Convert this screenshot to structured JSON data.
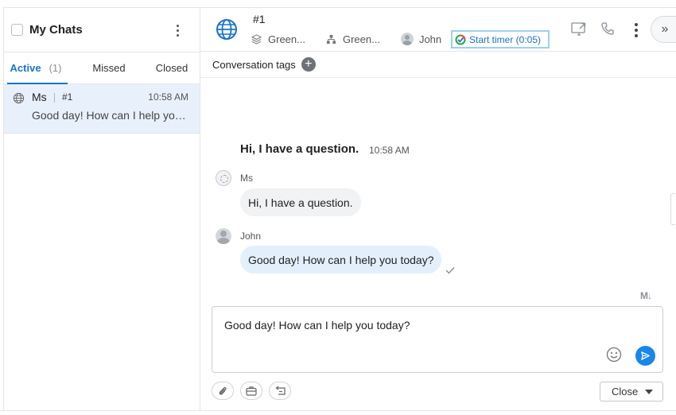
{
  "sidebar": {
    "title": "My Chats",
    "tabs": [
      {
        "label": "Active",
        "count": "(1)"
      },
      {
        "label": "Missed"
      },
      {
        "label": "Closed"
      }
    ],
    "chats": [
      {
        "name": "Ms",
        "number": "#1",
        "time": "10:58 AM",
        "preview": "Good day! How can I help you today?"
      }
    ]
  },
  "header": {
    "chat_number": "#1",
    "department": "Green...",
    "group": "Green...",
    "agent": "John",
    "timer_label": "Start timer (0:05)"
  },
  "tags": {
    "label": "Conversation tags",
    "add": "+"
  },
  "messages": {
    "summary_text": "Hi, I have a question.",
    "summary_time": "10:58 AM",
    "items": [
      {
        "sender": "Ms",
        "text": "Hi, I have a question."
      },
      {
        "sender": "John",
        "text": "Good day! How can I help you today?"
      }
    ]
  },
  "composer": {
    "text": "Good day! How can I help you today?",
    "markdown_label": "M↓"
  },
  "actions": {
    "close_label": "Close",
    "expand": "»"
  },
  "colors": {
    "accent": "#1a73c8",
    "selected_row": "#e8f1fb",
    "outgoing_bubble": "#e3f0fc",
    "incoming_bubble": "#f1f2f4",
    "send_button": "#1a86e8"
  }
}
